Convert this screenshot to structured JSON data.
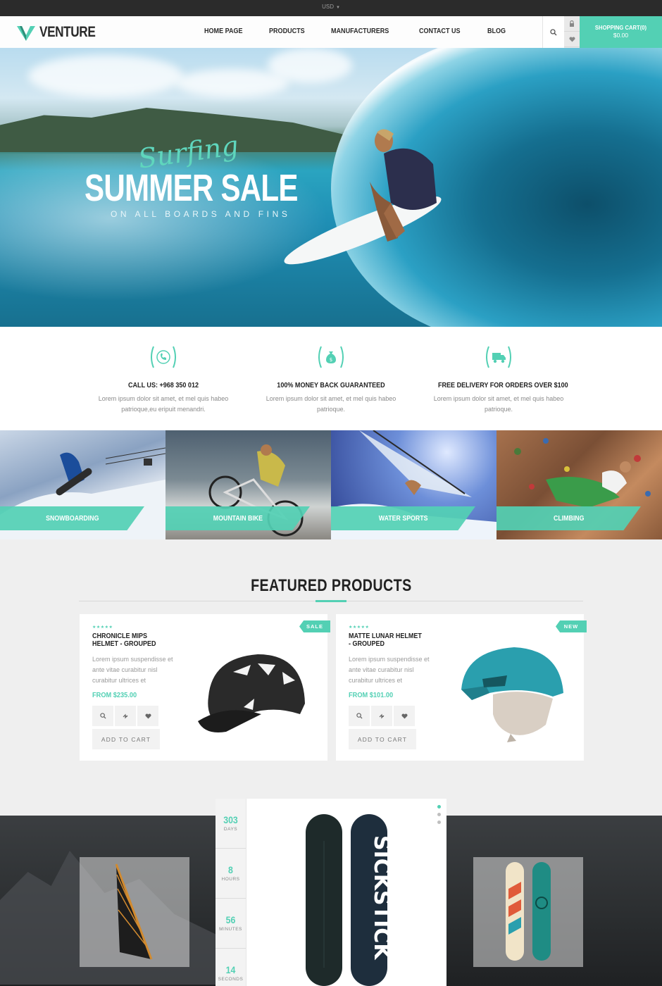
{
  "topbar": {
    "currency": "USD"
  },
  "header": {
    "brand": "VENTURE",
    "nav": [
      "HOME PAGE",
      "PRODUCTS",
      "MANUFACTURERS",
      "CONTACT US",
      "BLOG"
    ],
    "cart_label": "SHOPPING CART(0)",
    "cart_total": "$0.00"
  },
  "hero": {
    "script": "Surfing",
    "headline": "SUMMER SALE",
    "subline": "ON ALL BOARDS AND FINS"
  },
  "features": [
    {
      "icon": "phone-icon",
      "title": "CALL US: +968 350 012",
      "desc": "Lorem ipsum dolor sit amet, et mel quis habeo patrioque,eu eripuit menandri."
    },
    {
      "icon": "money-bag-icon",
      "title": "100% MONEY BACK GUARANTEED",
      "desc": "Lorem ipsum dolor sit amet, et mel quis habeo patrioque."
    },
    {
      "icon": "delivery-truck-icon",
      "title": "FREE DELIVERY FOR ORDERS OVER $100",
      "desc": "Lorem ipsum dolor sit amet, et mel quis habeo patrioque."
    }
  ],
  "categories": [
    "SNOWBOARDING",
    "MOUNTAIN BIKE",
    "WATER SPORTS",
    "CLIMBING"
  ],
  "featured": {
    "title": "FEATURED PRODUCTS",
    "products": [
      {
        "rating": 5,
        "stars": "★★★★★",
        "name": "CHRONICLE MIPS HELMET - GROUPED",
        "desc": "Lorem ipsum suspendisse et ante vitae curabitur nisl curabitur ultrices et",
        "price": "FROM $235.00",
        "badge": "SALE",
        "add_to_cart": "ADD TO CART"
      },
      {
        "rating": 5,
        "stars": "★★★★★",
        "name": "MATTE LUNAR HELMET - GROUPED",
        "desc": "Lorem ipsum suspendisse et ante vitae curabitur nisl curabitur ultrices et",
        "price": "FROM $101.00",
        "badge": "NEW",
        "add_to_cart": "ADD TO CART"
      }
    ]
  },
  "countdown": [
    {
      "value": "303",
      "label": "DAYS"
    },
    {
      "value": "8",
      "label": "HOURS"
    },
    {
      "value": "56",
      "label": "MINUTES"
    },
    {
      "value": "14",
      "label": "SECONDS"
    }
  ],
  "spotlight": {
    "board_text": "SICKSTICK"
  },
  "colors": {
    "accent": "#53d0b4",
    "topbar": "#2b2b2b",
    "dark_band": "#2c2f31"
  }
}
